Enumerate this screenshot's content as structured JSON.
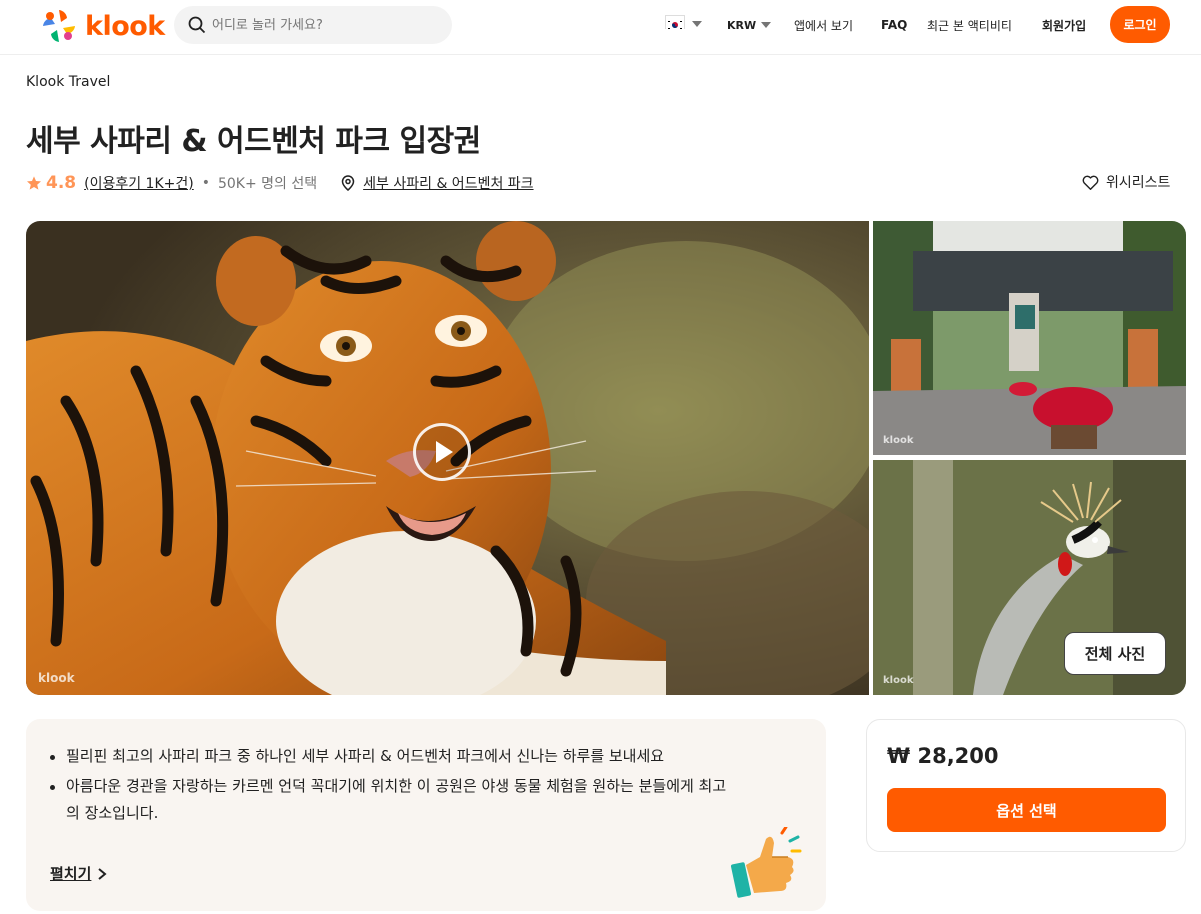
{
  "header": {
    "logo_text": "klook",
    "search_placeholder": "어디로 놀러 가세요?",
    "currency": "KRW",
    "app_link": "앱에서 보기",
    "faq": "FAQ",
    "recent": "최근 본 액티비티",
    "signup": "회원가입",
    "login": "로그인",
    "accent": "#ff5b00"
  },
  "breadcrumb": "Klook Travel",
  "title": "세부 사파리 & 어드벤처 파크 입장권",
  "meta": {
    "rating": "4.8",
    "reviews": "(이용후기 1K+건)",
    "separator": "•",
    "booked": "50K+ 명의 선택",
    "location": "세부 사파리 & 어드벤처 파크",
    "wishlist": "위시리스트"
  },
  "gallery": {
    "watermark": "klook",
    "all_photos": "전체 사진"
  },
  "highlights": {
    "items": [
      "필리핀 최고의 사파리 파크 중 하나인 세부 사파리 & 어드벤처 파크에서 신나는 하루를 보내세요",
      "아름다운 경관을 자랑하는 카르멘 언덕 꼭대기에 위치한 이 공원은 야생 동물 체험을 원하는 분들에게 최고의 장소입니다."
    ],
    "expand": "펼치기"
  },
  "price_card": {
    "price": "₩ 28,200",
    "select": "옵션 선택"
  }
}
